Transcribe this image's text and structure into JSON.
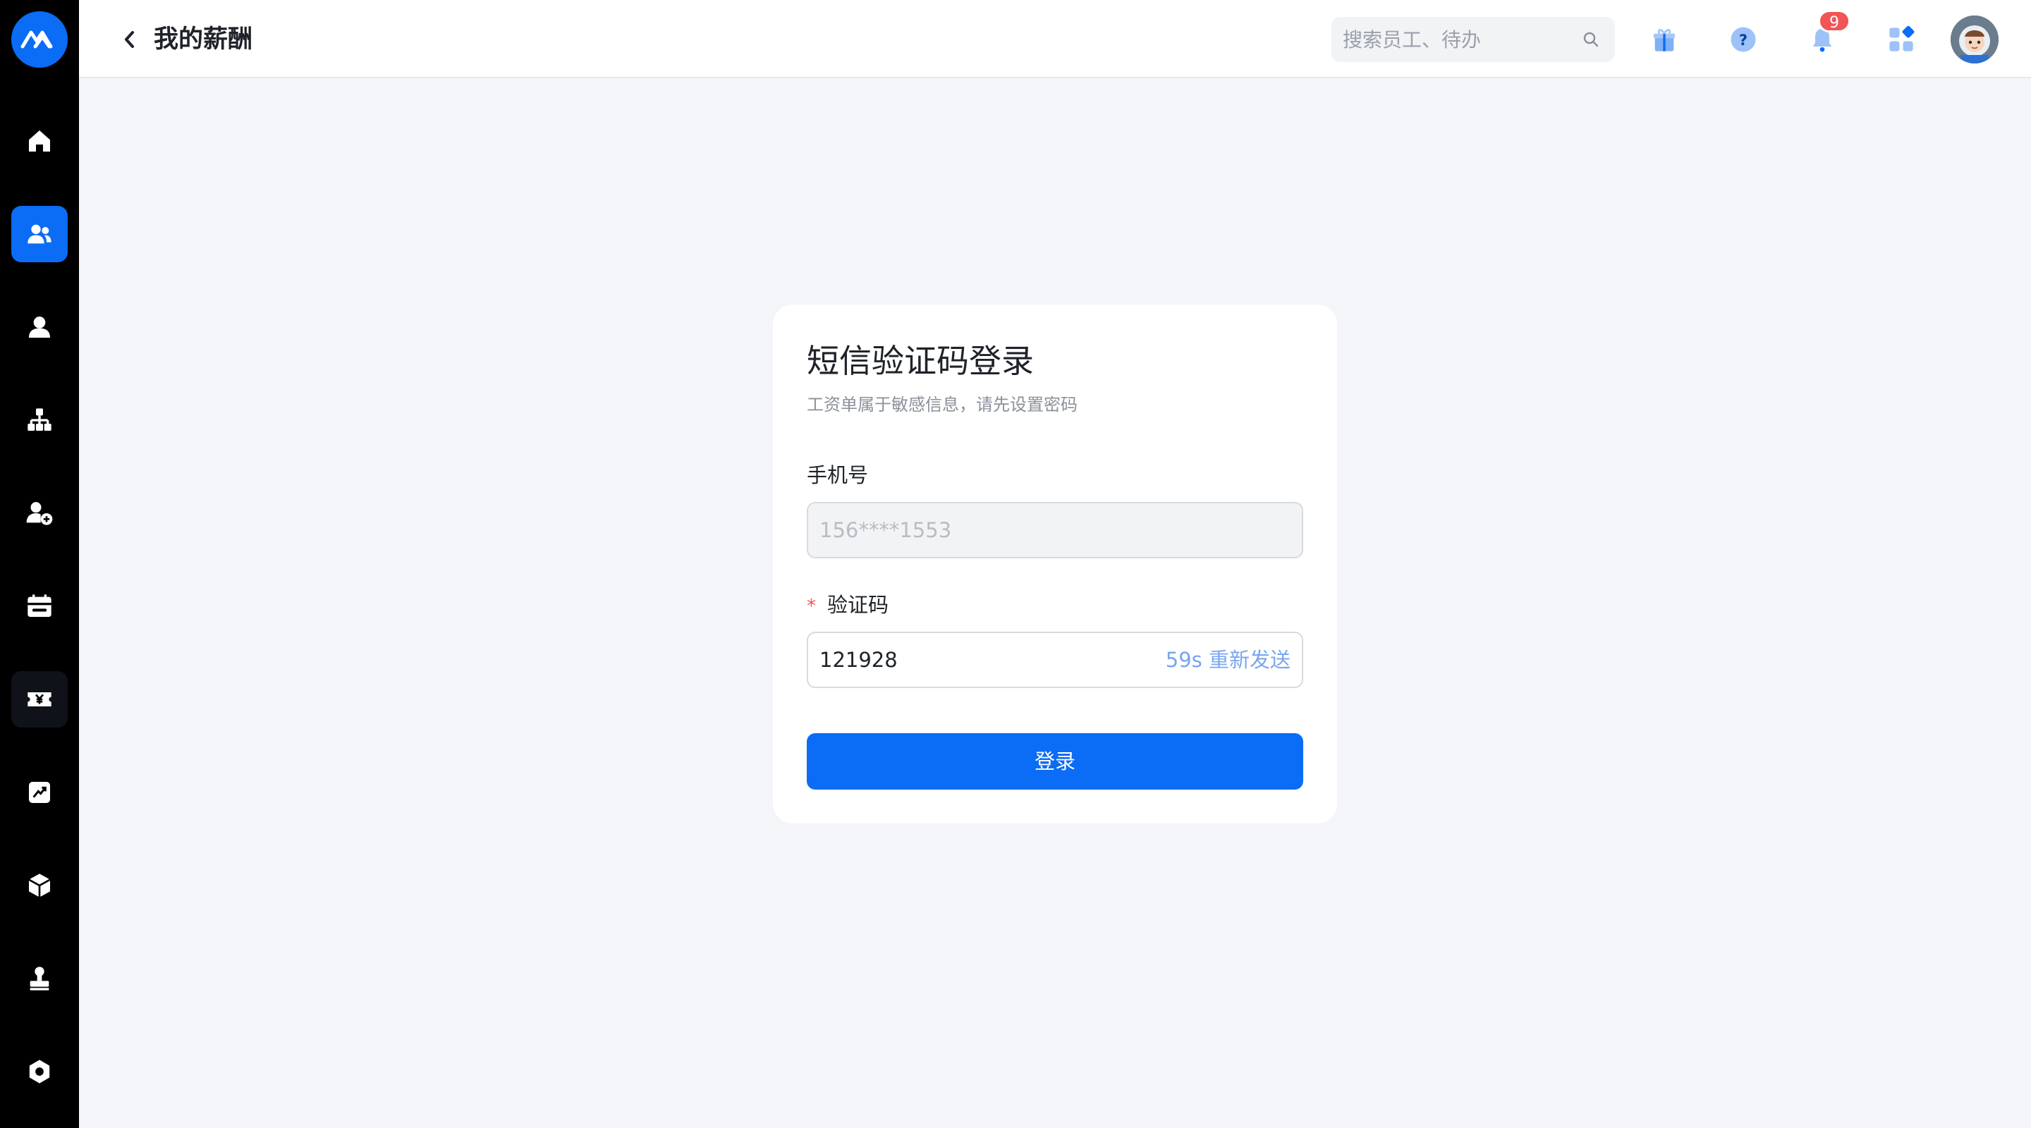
{
  "sidebar": {
    "logo": "brand-logo-icon",
    "items": [
      {
        "icon": "home-icon",
        "active": false
      },
      {
        "icon": "users-icon",
        "active": true
      },
      {
        "icon": "person-icon",
        "active": false
      },
      {
        "icon": "org-chart-icon",
        "active": false
      },
      {
        "icon": "person-add-icon",
        "active": false
      },
      {
        "icon": "calendar-icon",
        "active": false
      },
      {
        "icon": "salary-yen-icon",
        "active": false
      },
      {
        "icon": "chart-report-icon",
        "active": false
      },
      {
        "icon": "box-icon",
        "active": false
      },
      {
        "icon": "stamp-icon",
        "active": false
      },
      {
        "icon": "settings-icon",
        "active": false
      }
    ]
  },
  "header": {
    "title": "我的薪酬",
    "search_placeholder": "搜索员工、待办",
    "notification_count": "9"
  },
  "login_card": {
    "title": "短信验证码登录",
    "subtitle": "工资单属于敏感信息，请先设置密码",
    "phone_label": "手机号",
    "phone_value": "156****1553",
    "code_required_mark": "*",
    "code_label": "验证码",
    "code_value": "121928",
    "resend_text": "59s 重新发送",
    "submit_label": "登录"
  },
  "colors": {
    "primary": "#0b6cf5",
    "sidebar_bg": "#000000",
    "page_bg": "#f4f5f9",
    "badge": "#f25555"
  }
}
